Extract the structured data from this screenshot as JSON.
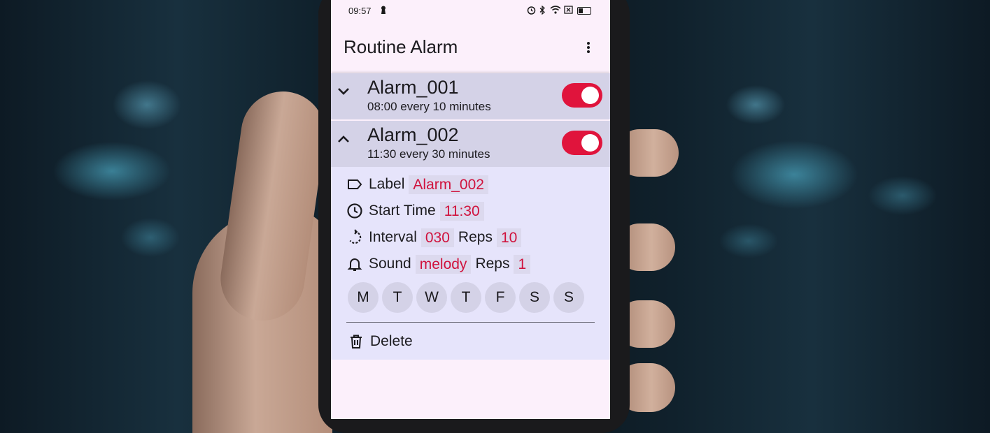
{
  "status_bar": {
    "time": "09:57"
  },
  "app": {
    "title": "Routine Alarm"
  },
  "alarms": [
    {
      "name": "Alarm_001",
      "summary": "08:00 every 10 minutes",
      "enabled": true,
      "expanded": false
    },
    {
      "name": "Alarm_002",
      "summary": "11:30 every 30 minutes",
      "enabled": true,
      "expanded": true
    }
  ],
  "details": {
    "label_text": "Label",
    "label_value": "Alarm_002",
    "start_text": "Start Time",
    "start_value": "11:30",
    "interval_text": "Interval",
    "interval_value": "030",
    "interval_reps_text": "Reps",
    "interval_reps_value": "10",
    "sound_text": "Sound",
    "sound_value": "melody",
    "sound_reps_text": "Reps",
    "sound_reps_value": "1",
    "days": [
      "M",
      "T",
      "W",
      "T",
      "F",
      "S",
      "S"
    ],
    "delete_text": "Delete"
  },
  "colors": {
    "accent": "#e0143c",
    "row_bg": "#d4d2e7",
    "detail_bg": "#e6e4fb",
    "screen_bg": "#fcf0fb"
  }
}
